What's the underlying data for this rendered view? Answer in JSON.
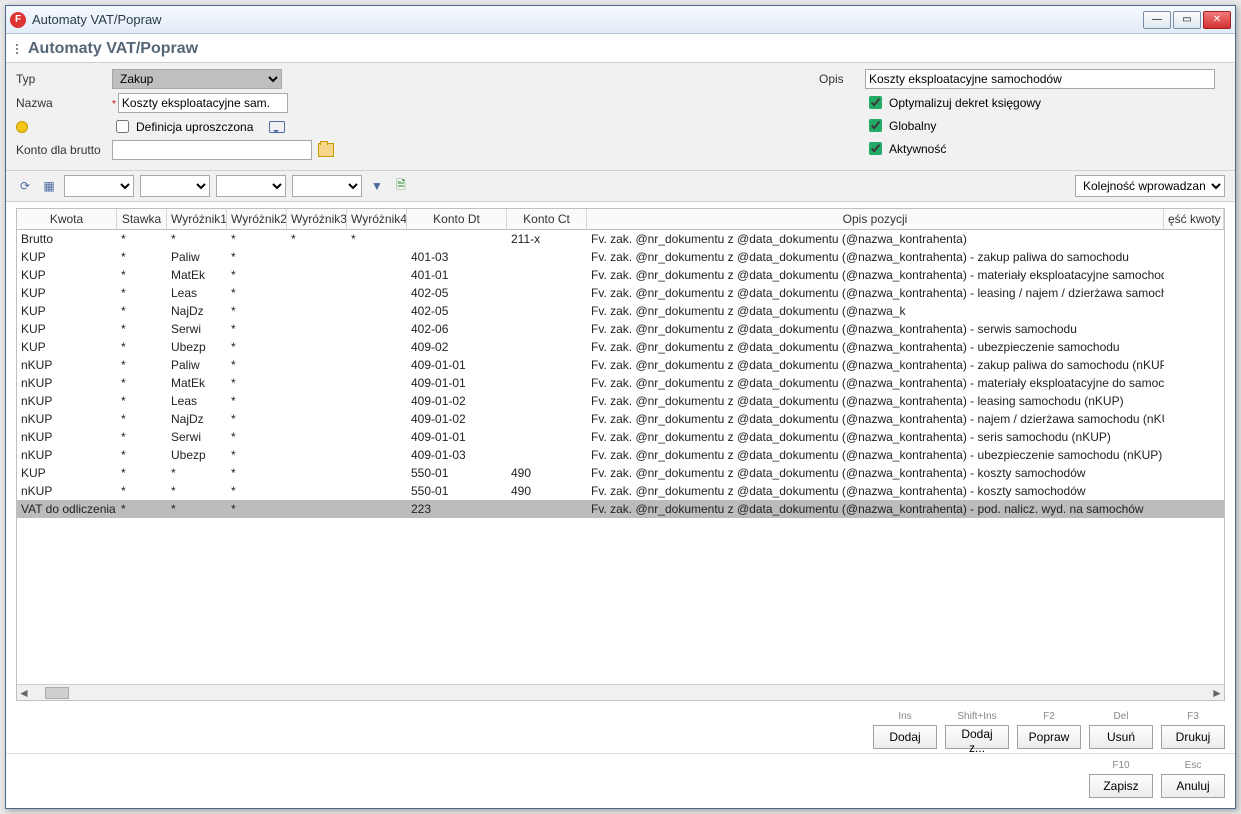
{
  "window": {
    "title": "Automaty VAT/Popraw",
    "subtitle": "Automaty VAT/Popraw"
  },
  "form": {
    "typ_label": "Typ",
    "typ_value": "Zakup",
    "nazwa_label": "Nazwa",
    "nazwa_value": "Koszty eksploatacyjne sam.",
    "def_label": "Definicja uproszczona",
    "konto_label": "Konto dla brutto",
    "konto_value": "",
    "opis_label": "Opis",
    "opis_value": "Koszty eksploatacyjne samochodów",
    "opt_label": "Optymalizuj dekret księgowy",
    "glob_label": "Globalny",
    "akt_label": "Aktywność"
  },
  "toolbar": {
    "order_label": "Kolejność wprowadzania"
  },
  "columns": [
    "Kwota",
    "Stawka",
    "Wyróżnik1",
    "Wyróżnik2",
    "Wyróżnik3",
    "Wyróżnik4",
    "Konto Dt",
    "Konto Ct",
    "Opis pozycji",
    "ęść kwoty"
  ],
  "rows": [
    {
      "kwota": "Brutto",
      "stawka": "*",
      "w1": "*",
      "w2": "*",
      "w3": "*",
      "w4": "*",
      "dt": "",
      "ct": "211-x",
      "opis": "Fv. zak. @nr_dokumentu z @data_dokumentu (@nazwa_kontrahenta)"
    },
    {
      "kwota": "KUP",
      "stawka": "*",
      "w1": "Paliw",
      "w2": "*",
      "w3": "",
      "w4": "",
      "dt": "401-03",
      "ct": "",
      "opis": "Fv. zak. @nr_dokumentu z @data_dokumentu (@nazwa_kontrahenta) - zakup paliwa do samochodu"
    },
    {
      "kwota": "KUP",
      "stawka": "*",
      "w1": "MatEk",
      "w2": "*",
      "w3": "",
      "w4": "",
      "dt": "401-01",
      "ct": "",
      "opis": "Fv. zak. @nr_dokumentu z @data_dokumentu (@nazwa_kontrahenta) - materiały eksploatacyjne samochodów"
    },
    {
      "kwota": "KUP",
      "stawka": "*",
      "w1": "Leas",
      "w2": "*",
      "w3": "",
      "w4": "",
      "dt": "402-05",
      "ct": "",
      "opis": "Fv. zak. @nr_dokumentu z @data_dokumentu (@nazwa_kontrahenta) - leasing / najem / dzierżawa samochodu"
    },
    {
      "kwota": "KUP",
      "stawka": "*",
      "w1": "NajDz",
      "w2": "*",
      "w3": "",
      "w4": "",
      "dt": "402-05",
      "ct": "",
      "opis": "Fv. zak. @nr_dokumentu z @data_dokumentu (@nazwa_k"
    },
    {
      "kwota": "KUP",
      "stawka": "*",
      "w1": "Serwi",
      "w2": "*",
      "w3": "",
      "w4": "",
      "dt": "402-06",
      "ct": "",
      "opis": "Fv. zak. @nr_dokumentu z @data_dokumentu (@nazwa_kontrahenta) - serwis samochodu"
    },
    {
      "kwota": "KUP",
      "stawka": "*",
      "w1": "Ubezp",
      "w2": "*",
      "w3": "",
      "w4": "",
      "dt": "409-02",
      "ct": "",
      "opis": "Fv. zak. @nr_dokumentu z @data_dokumentu (@nazwa_kontrahenta) - ubezpieczenie samochodu"
    },
    {
      "kwota": "nKUP",
      "stawka": "*",
      "w1": "Paliw",
      "w2": "*",
      "w3": "",
      "w4": "",
      "dt": "409-01-01",
      "ct": "",
      "opis": "Fv. zak. @nr_dokumentu z @data_dokumentu (@nazwa_kontrahenta) - zakup paliwa do samochodu (nKUP)"
    },
    {
      "kwota": "nKUP",
      "stawka": "*",
      "w1": "MatEk",
      "w2": "*",
      "w3": "",
      "w4": "",
      "dt": "409-01-01",
      "ct": "",
      "opis": "Fv. zak. @nr_dokumentu z @data_dokumentu (@nazwa_kontrahenta) - materiały eksploatacyjne do samochodów (nKUP)"
    },
    {
      "kwota": "nKUP",
      "stawka": "*",
      "w1": "Leas",
      "w2": "*",
      "w3": "",
      "w4": "",
      "dt": "409-01-02",
      "ct": "",
      "opis": "Fv. zak. @nr_dokumentu z @data_dokumentu (@nazwa_kontrahenta) - leasing samochodu (nKUP)"
    },
    {
      "kwota": "nKUP",
      "stawka": "*",
      "w1": "NajDz",
      "w2": "*",
      "w3": "",
      "w4": "",
      "dt": "409-01-02",
      "ct": "",
      "opis": "Fv. zak. @nr_dokumentu z @data_dokumentu (@nazwa_kontrahenta) - najem / dzierżawa samochodu (nKUP)"
    },
    {
      "kwota": "nKUP",
      "stawka": "*",
      "w1": "Serwi",
      "w2": "*",
      "w3": "",
      "w4": "",
      "dt": "409-01-01",
      "ct": "",
      "opis": "Fv. zak. @nr_dokumentu z @data_dokumentu (@nazwa_kontrahenta) - seris samochodu (nKUP)"
    },
    {
      "kwota": "nKUP",
      "stawka": "*",
      "w1": "Ubezp",
      "w2": "*",
      "w3": "",
      "w4": "",
      "dt": "409-01-03",
      "ct": "",
      "opis": "Fv. zak. @nr_dokumentu z @data_dokumentu (@nazwa_kontrahenta) - ubezpieczenie samochodu (nKUP)"
    },
    {
      "kwota": "KUP",
      "stawka": "*",
      "w1": "*",
      "w2": "*",
      "w3": "",
      "w4": "",
      "dt": "550-01",
      "ct": "490",
      "opis": "Fv. zak. @nr_dokumentu z @data_dokumentu (@nazwa_kontrahenta) - koszty samochodów"
    },
    {
      "kwota": "nKUP",
      "stawka": "*",
      "w1": "*",
      "w2": "*",
      "w3": "",
      "w4": "",
      "dt": "550-01",
      "ct": "490",
      "opis": "Fv. zak. @nr_dokumentu z @data_dokumentu (@nazwa_kontrahenta) - koszty samochodów"
    },
    {
      "kwota": "VAT do odliczenia",
      "stawka": "*",
      "w1": "*",
      "w2": "*",
      "w3": "",
      "w4": "",
      "dt": "223",
      "ct": "",
      "opis": "Fv. zak. @nr_dokumentu z @data_dokumentu (@nazwa_kontrahenta) - pod. nalicz. wyd. na samochów",
      "selected": true
    }
  ],
  "buttons": {
    "dodaj_hint": "Ins",
    "dodaj": "Dodaj",
    "dodajz_hint": "Shift+Ins",
    "dodajz": "Dodaj z...",
    "popraw_hint": "F2",
    "popraw": "Popraw",
    "usun_hint": "Del",
    "usun": "Usuń",
    "drukuj_hint": "F3",
    "drukuj": "Drukuj",
    "zapisz_hint": "F10",
    "zapisz": "Zapisz",
    "anuluj_hint": "Esc",
    "anuluj": "Anuluj"
  }
}
